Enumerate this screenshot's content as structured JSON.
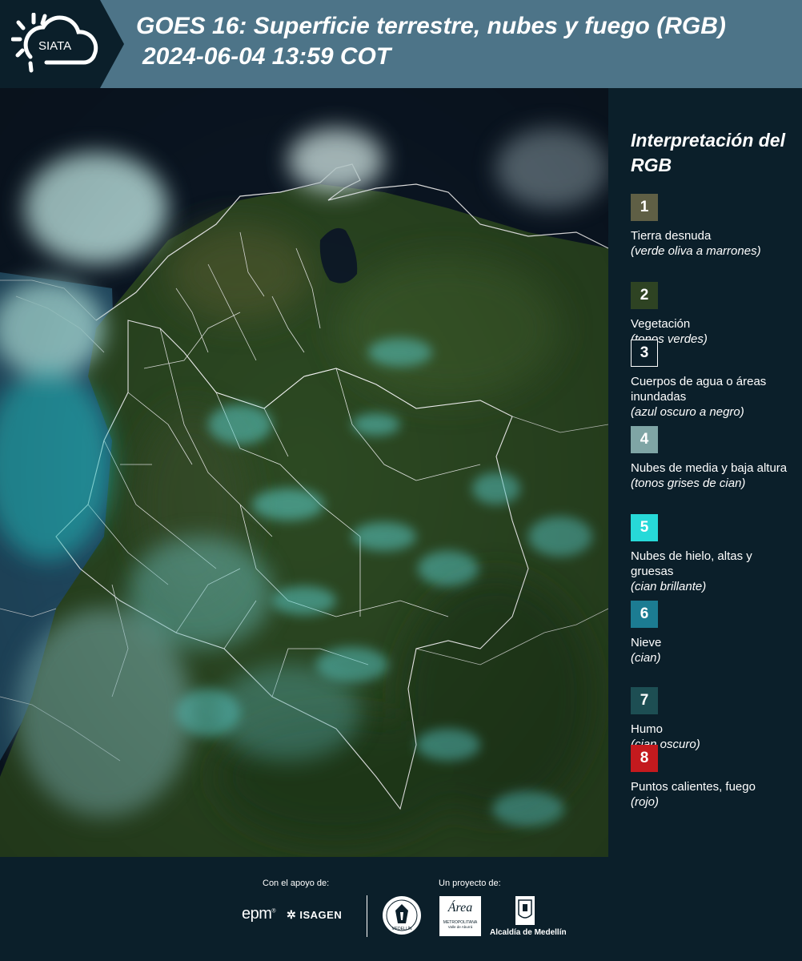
{
  "header": {
    "logo_text": "SIATA",
    "title_line1": "GOES 16: Superficie terrestre, nubes y fuego (RGB)",
    "title_line2": "2024-06-04 13:59 COT"
  },
  "legend": {
    "title": "Interpretación del RGB",
    "items": [
      {
        "num": "1",
        "label": "Tierra desnuda",
        "sub": "(verde oliva a marrones)",
        "color": "#5f5f45"
      },
      {
        "num": "2",
        "label": "Vegetación",
        "sub": "(tonos verdes)",
        "color": "#2e4323"
      },
      {
        "num": "3",
        "label": "Cuerpos de agua o áreas inundadas",
        "sub": "(azul oscuro a negro)",
        "color": "#0b1f2a"
      },
      {
        "num": "4",
        "label": "Nubes de media y baja altura",
        "sub": "(tonos grises de cian)",
        "color": "#7fa5a5"
      },
      {
        "num": "5",
        "label": "Nubes de hielo, altas y gruesas",
        "sub": "(cian brillante)",
        "color": "#27d9d8"
      },
      {
        "num": "6",
        "label": "Nieve",
        "sub": "(cian)",
        "color": "#1c7c92"
      },
      {
        "num": "7",
        "label": "Humo",
        "sub": "(cian oscuro)",
        "color": "#1d4e53"
      },
      {
        "num": "8",
        "label": "Puntos calientes, fuego",
        "sub": "(rojo)",
        "color": "#c41a1e"
      }
    ]
  },
  "footer": {
    "support_label": "Con el apoyo de:",
    "project_label": "Un proyecto de:",
    "logo_epm": "epm",
    "logo_isagen": "ISAGEN",
    "logo_area_line1": "Área",
    "logo_area_line2": "METROPOLITANA",
    "logo_area_line3": "Valle de Aburrá",
    "logo_alcaldia": "Alcaldía de Medellín",
    "logo_medellin_seal": "MEDELLÍN"
  }
}
